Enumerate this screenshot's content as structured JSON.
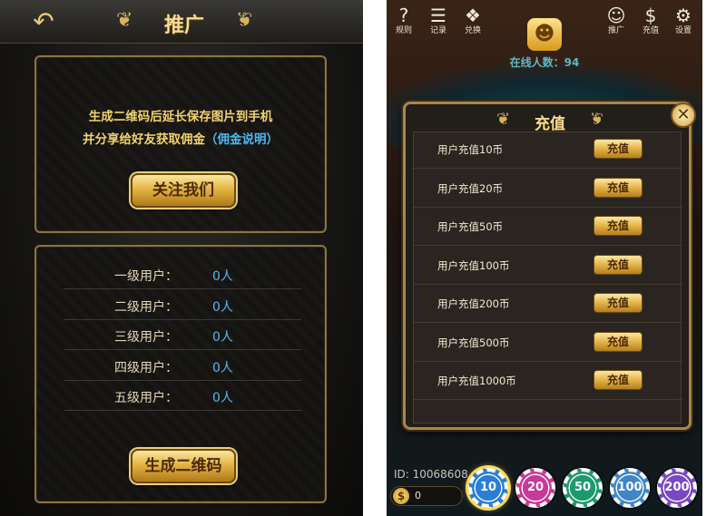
{
  "left": {
    "title": "推广",
    "info_line1": "生成二维码后延长保存图片到手机",
    "info_line2_prefix": "并分享给好友获取佣金",
    "info_link": "（佣金说明）",
    "follow_label": "关注我们",
    "qr_label": "生成二维码",
    "user_levels": [
      {
        "label": "一级用户：",
        "value": "0人"
      },
      {
        "label": "二级用户：",
        "value": "0人"
      },
      {
        "label": "三级用户：",
        "value": "0人"
      },
      {
        "label": "四级用户：",
        "value": "0人"
      },
      {
        "label": "五级用户：",
        "value": "0人"
      }
    ]
  },
  "right": {
    "top_icons": [
      {
        "icon": "question-icon",
        "label": "规则"
      },
      {
        "icon": "clipboard-icon",
        "label": "记录"
      },
      {
        "icon": "gift-icon",
        "label": "兑换"
      },
      {
        "icon": "group-icon",
        "label": "推广"
      },
      {
        "icon": "moneybag-icon",
        "label": "充值"
      },
      {
        "icon": "gear-icon",
        "label": "设置"
      }
    ],
    "online_label": "在线人数：",
    "online_count": "94",
    "modal_title": "充值",
    "recharge_items": [
      {
        "label": "用户充值10币",
        "button": "充值"
      },
      {
        "label": "用户充值20币",
        "button": "充值"
      },
      {
        "label": "用户充值50币",
        "button": "充值"
      },
      {
        "label": "用户充值100币",
        "button": "充值"
      },
      {
        "label": "用户充值200币",
        "button": "充值"
      },
      {
        "label": "用户充值500币",
        "button": "充值"
      },
      {
        "label": "用户充值1000币",
        "button": "充值"
      }
    ],
    "id_text": "ID: 10068608",
    "coin_balance": "0",
    "chips": [
      {
        "value": "10",
        "color": "#2a7fd4"
      },
      {
        "value": "20",
        "color": "#c8399a"
      },
      {
        "value": "50",
        "color": "#1e9a6e"
      },
      {
        "value": "100",
        "color": "#3f86c9"
      },
      {
        "value": "200",
        "color": "#7a48c2"
      }
    ],
    "selected_chip": "10"
  }
}
